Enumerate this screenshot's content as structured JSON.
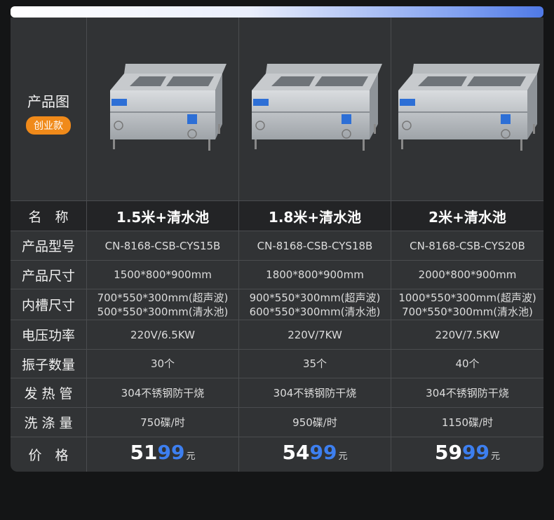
{
  "header": {
    "title": "产品图",
    "badge": "创业款"
  },
  "rows": {
    "name": "名　称",
    "model": "产品型号",
    "size": "产品尺寸",
    "tank": "内槽尺寸",
    "power": "电压功率",
    "vibrators": "振子数量",
    "heater": "发 热 管",
    "capacity": "洗 涤 量",
    "price": "价　格"
  },
  "products": [
    {
      "name": "1.5米+清水池",
      "model": "CN-8168-CSB-CYS15B",
      "size": "1500*800*900mm",
      "tank_1": "700*550*300mm(超声波)",
      "tank_2": "500*550*300mm(清水池)",
      "power": "220V/6.5KW",
      "vibrators": "30个",
      "heater": "304不锈钢防干烧",
      "capacity": "750碟/时",
      "price_hi": "51",
      "price_lo": "99",
      "price_unit": "元"
    },
    {
      "name": "1.8米+清水池",
      "model": "CN-8168-CSB-CYS18B",
      "size": "1800*800*900mm",
      "tank_1": "900*550*300mm(超声波)",
      "tank_2": "600*550*300mm(清水池)",
      "power": "220V/7KW",
      "vibrators": "35个",
      "heater": "304不锈钢防干烧",
      "capacity": "950碟/时",
      "price_hi": "54",
      "price_lo": "99",
      "price_unit": "元"
    },
    {
      "name": "2米+清水池",
      "model": "CN-8168-CSB-CYS20B",
      "size": "2000*800*900mm",
      "tank_1": "1000*550*300mm(超声波)",
      "tank_2": "700*550*300mm(清水池)",
      "power": "220V/7.5KW",
      "vibrators": "40个",
      "heater": "304不锈钢防干烧",
      "capacity": "1150碟/时",
      "price_hi": "59",
      "price_lo": "99",
      "price_unit": "元"
    }
  ],
  "colors": {
    "accent_blue": "#3d7ff0",
    "badge_orange": "#f08a1a",
    "panel": "#313335",
    "background": "#141516"
  }
}
